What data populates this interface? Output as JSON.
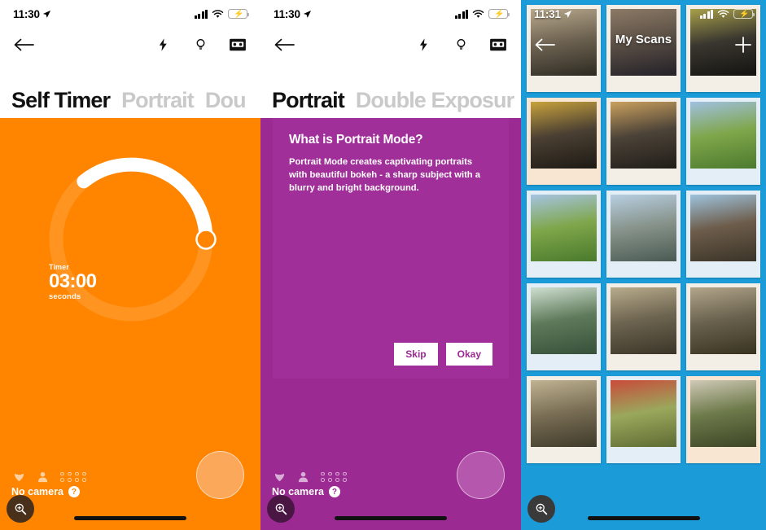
{
  "screens": [
    {
      "id": "self-timer",
      "accent": "#ff8500",
      "statusbar": {
        "time": "11:30",
        "location_icon": "location-arrow-icon",
        "signal_icon": "cellular-signal-icon",
        "wifi_icon": "wifi-icon",
        "battery_icon": "battery-charging-icon"
      },
      "nav": {
        "back_icon": "back-arrow-icon",
        "icons": [
          "flash-icon",
          "lightbulb-icon",
          "film-camera-icon"
        ]
      },
      "tabs": [
        {
          "label": "Self Timer",
          "active": true
        },
        {
          "label": "Portrait",
          "active": false
        },
        {
          "label": "Dou",
          "active": false
        }
      ],
      "timer": {
        "label": "Timer",
        "value": "03:00",
        "unit": "seconds",
        "progress_percent": 39
      },
      "bottom": {
        "status_text": "No camera",
        "help_icon": "help-icon",
        "mini_icons": [
          "leaf-icon",
          "person-icon",
          "dot-grid-icon"
        ],
        "shutter_icon": "shutter-button",
        "zoom_icon": "zoom-in-icon",
        "home_indicator": "home-indicator"
      }
    },
    {
      "id": "portrait",
      "accent": "#9c2a93",
      "statusbar": {
        "time": "11:30",
        "location_icon": "location-arrow-icon",
        "signal_icon": "cellular-signal-icon",
        "wifi_icon": "wifi-icon",
        "battery_icon": "battery-charging-icon"
      },
      "nav": {
        "back_icon": "back-arrow-icon",
        "icons": [
          "flash-icon",
          "lightbulb-icon",
          "film-camera-icon"
        ]
      },
      "tabs": [
        {
          "label": "Portrait",
          "active": true
        },
        {
          "label": "Double Exposur",
          "active": false
        }
      ],
      "dialog": {
        "title": "What is Portrait Mode?",
        "body": "Portrait Mode creates captivating portraits with beautiful bokeh - a sharp subject with a blurry and bright background.",
        "skip_label": "Skip",
        "okay_label": "Okay"
      },
      "bottom": {
        "status_text": "No camera",
        "help_icon": "help-icon",
        "mini_icons": [
          "leaf-icon",
          "person-icon",
          "dot-grid-icon"
        ],
        "shutter_icon": "shutter-button",
        "zoom_icon": "zoom-in-icon",
        "home_indicator": "home-indicator"
      }
    },
    {
      "id": "my-scans",
      "accent": "#1b9bd8",
      "statusbar": {
        "time": "11:31",
        "location_icon": "location-arrow-icon",
        "signal_icon": "cellular-signal-icon",
        "wifi_icon": "wifi-icon",
        "battery_icon": "battery-charging-icon"
      },
      "nav": {
        "back_icon": "back-arrow-icon",
        "add_icon": "plus-icon"
      },
      "title": "My Scans",
      "bottom": {
        "zoom_icon": "zoom-in-icon",
        "home_indicator": "home-indicator"
      },
      "photos": [
        {
          "frame": "neutral",
          "subject": "field-at-dusk",
          "c1": "#6e6352",
          "c2": "#2d2a22",
          "c3": "#b9a98c"
        },
        {
          "frame": "neutral",
          "subject": "woman-portrait-outdoors",
          "c1": "#5a4f45",
          "c2": "#232028",
          "c3": "#8d7a66"
        },
        {
          "frame": "neutral",
          "subject": "person-yellow-jacket-night",
          "c1": "#3a3730",
          "c2": "#141310",
          "c3": "#a8a04a"
        },
        {
          "frame": "warm",
          "subject": "two-people-on-bench",
          "c1": "#4b4033",
          "c2": "#1d1a14",
          "c3": "#c8a23c"
        },
        {
          "frame": "neutral",
          "subject": "woman-sitting-at-sunset",
          "c1": "#4c4338",
          "c2": "#201d18",
          "c3": "#caa05e"
        },
        {
          "frame": "cool",
          "subject": "dog-in-park",
          "c1": "#7fa64a",
          "c2": "#4c7a2e",
          "c3": "#9fc0e0"
        },
        {
          "frame": "cool",
          "subject": "dog-in-park-2",
          "c1": "#7fa64a",
          "c2": "#497a2c",
          "c3": "#a5c4e2"
        },
        {
          "frame": "cool",
          "subject": "person-on-rocks",
          "c1": "#87938b",
          "c2": "#4a5a52",
          "c3": "#b8cfe2"
        },
        {
          "frame": "cool",
          "subject": "people-on-cliff-picnic",
          "c1": "#6d5c4a",
          "c2": "#3a3428",
          "c3": "#9ec3dd"
        },
        {
          "frame": "cool",
          "subject": "forest-trees",
          "c1": "#5e7a5a",
          "c2": "#37503a",
          "c3": "#cfdfd0"
        },
        {
          "frame": "neutral",
          "subject": "three-friends-on-road",
          "c1": "#6d6450",
          "c2": "#3a3528",
          "c3": "#b8ac8c"
        },
        {
          "frame": "neutral",
          "subject": "three-friends-waving",
          "c1": "#6a624f",
          "c2": "#37331f",
          "c3": "#b2a68a"
        },
        {
          "frame": "neutral",
          "subject": "three-friends-posing",
          "c1": "#7a6e55",
          "c2": "#3e3a2a",
          "c3": "#c0b392"
        },
        {
          "frame": "cool",
          "subject": "red-car-driveway",
          "c1": "#9aa85c",
          "c2": "#5e6b33",
          "c3": "#c94b3a"
        },
        {
          "frame": "warm",
          "subject": "man-peace-sign",
          "c1": "#6d7a4a",
          "c2": "#3c4526",
          "c3": "#cfc9b6"
        }
      ]
    }
  ]
}
